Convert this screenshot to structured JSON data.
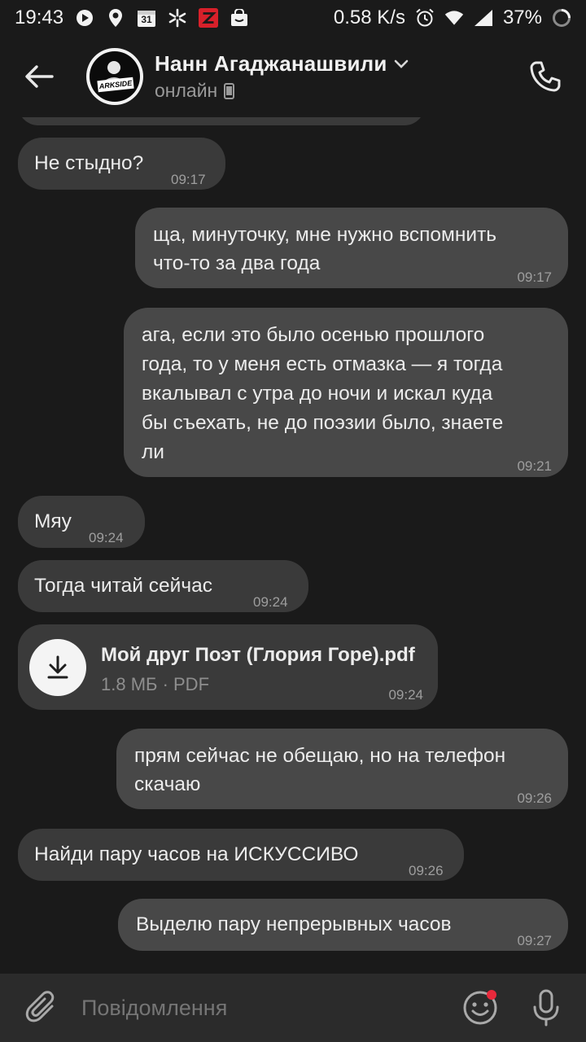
{
  "status_bar": {
    "time": "19:43",
    "network_speed": "0.58 K/s",
    "battery": "37%",
    "calendar_day": "31",
    "left_icons": [
      "play-icon",
      "location-icon",
      "calendar-icon",
      "sparkle-icon",
      "app-z-icon",
      "shop-icon"
    ],
    "right_icons": [
      "alarm-icon",
      "wifi-icon",
      "signal-icon",
      "battery-icon"
    ]
  },
  "header": {
    "contact_name": "Нанн Агаджанашвили",
    "status": "онлайн",
    "avatar_text": "ARKSIDE"
  },
  "messages": [
    {
      "side": "in",
      "text": "Не стыдно?",
      "time": "09:17"
    },
    {
      "side": "out",
      "lines": [
        "ща, минуточку, мне нужно вспомнить",
        "что-то за два года"
      ],
      "time": "09:17"
    },
    {
      "side": "out",
      "lines": [
        "ага, если это было осенью прошлого",
        "года, то у меня есть отмазка — я тогда",
        "вкалывал с утра до ночи и искал куда",
        "бы съехать, не до поэзии было, знаете",
        "ли"
      ],
      "time": "09:21"
    },
    {
      "side": "in",
      "text": "Мяу",
      "time": "09:24"
    },
    {
      "side": "in",
      "text": "Тогда читай сейчас",
      "time": "09:24"
    },
    {
      "side": "in",
      "type": "file",
      "file_name": "Мой друг Поэт (Глория Горе).pdf",
      "file_meta": "1.8 МБ · PDF",
      "time": "09:24"
    },
    {
      "side": "out",
      "lines": [
        "прям сейчас не обещаю, но на телефон",
        "скачаю"
      ],
      "time": "09:26"
    },
    {
      "side": "in",
      "text": "Найди пару часов на ИСКУССИВО",
      "time": "09:26"
    },
    {
      "side": "out",
      "text": "Выделю пару непрерывных часов",
      "time": "09:27"
    }
  ],
  "composer": {
    "placeholder": "Повідомлення"
  },
  "colors": {
    "background": "#1a1a1a",
    "incoming_bubble": "#3a3a3a",
    "outgoing_bubble": "#484848",
    "composer": "#2b2b2b",
    "notification_dot": "#e8293b"
  }
}
